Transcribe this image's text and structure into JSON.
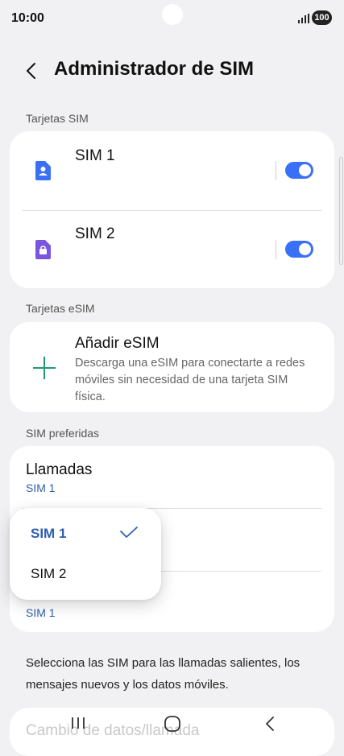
{
  "status_bar": {
    "time": "10:00",
    "battery": "100"
  },
  "header": {
    "title": "Administrador de SIM"
  },
  "sections": {
    "sim_cards": "Tarjetas SIM",
    "esim_cards": "Tarjetas eSIM",
    "preferred": "SIM preferidas"
  },
  "sim_cards": [
    {
      "label": "SIM 1",
      "enabled": true,
      "color": "#3a6ff7"
    },
    {
      "label": "SIM 2",
      "enabled": true,
      "color": "#7b55e0"
    }
  ],
  "esim": {
    "title": "Añadir eSIM",
    "description": "Descarga una eSIM para conectarte a redes móviles sin necesidad de una tarjeta SIM física."
  },
  "preferred": {
    "calls": {
      "title": "Llamadas",
      "value": "SIM 1"
    },
    "third": {
      "value": "SIM 1"
    }
  },
  "dropdown": {
    "options": [
      "SIM 1",
      "SIM 2"
    ],
    "selected": "SIM 1"
  },
  "footer_text": "Selecciona las SIM para las llamadas salientes, los mensajes nuevos y los datos móviles.",
  "faded_item": "Cambio de datos/llamada",
  "colors": {
    "accent": "#3a6ff7",
    "link": "#2f5fae",
    "add_icon": "#1f9b6e"
  }
}
